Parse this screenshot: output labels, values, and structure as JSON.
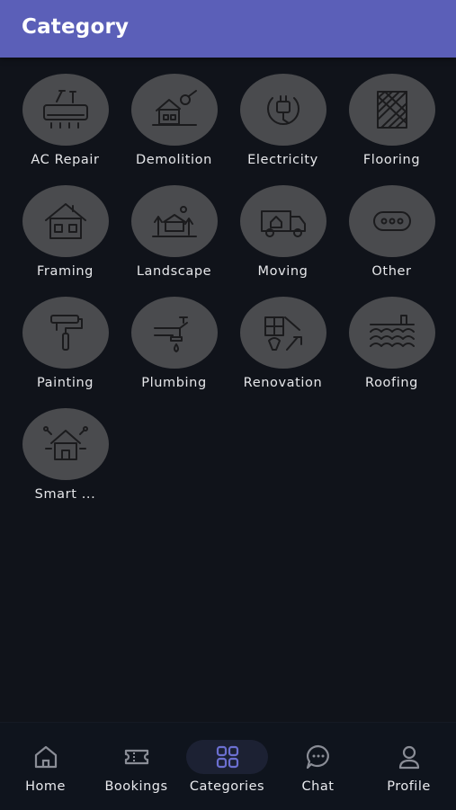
{
  "header": {
    "title": "Category"
  },
  "categories": [
    {
      "label": "AC Repair",
      "icon": "ac-repair-icon"
    },
    {
      "label": "Demolition",
      "icon": "demolition-icon"
    },
    {
      "label": "Electricity",
      "icon": "electric-plug-icon"
    },
    {
      "label": "Flooring",
      "icon": "flooring-icon"
    },
    {
      "label": "Framing",
      "icon": "house-frame-icon"
    },
    {
      "label": "Landscape",
      "icon": "landscape-icon"
    },
    {
      "label": "Moving",
      "icon": "moving-truck-icon"
    },
    {
      "label": "Other",
      "icon": "more-dots-icon"
    },
    {
      "label": "Painting",
      "icon": "paint-roller-icon"
    },
    {
      "label": "Plumbing",
      "icon": "plumbing-pipe-icon"
    },
    {
      "label": "Renovation",
      "icon": "renovation-tools-icon"
    },
    {
      "label": "Roofing",
      "icon": "roof-tiles-icon"
    },
    {
      "label": "Smart ...",
      "icon": "smart-home-icon"
    }
  ],
  "nav": {
    "items": [
      {
        "label": "Home",
        "icon": "home-icon"
      },
      {
        "label": "Bookings",
        "icon": "ticket-icon"
      },
      {
        "label": "Categories",
        "icon": "grid-icon",
        "active": true
      },
      {
        "label": "Chat",
        "icon": "chat-bubble-icon"
      },
      {
        "label": "Profile",
        "icon": "profile-icon"
      }
    ]
  },
  "colors": {
    "header": "#5b5fb8",
    "background": "#10131a",
    "icon_circle": "#4a4b4e",
    "active_nav_icon": "#6b6fd0",
    "nav_icon": "#8a8d96"
  }
}
